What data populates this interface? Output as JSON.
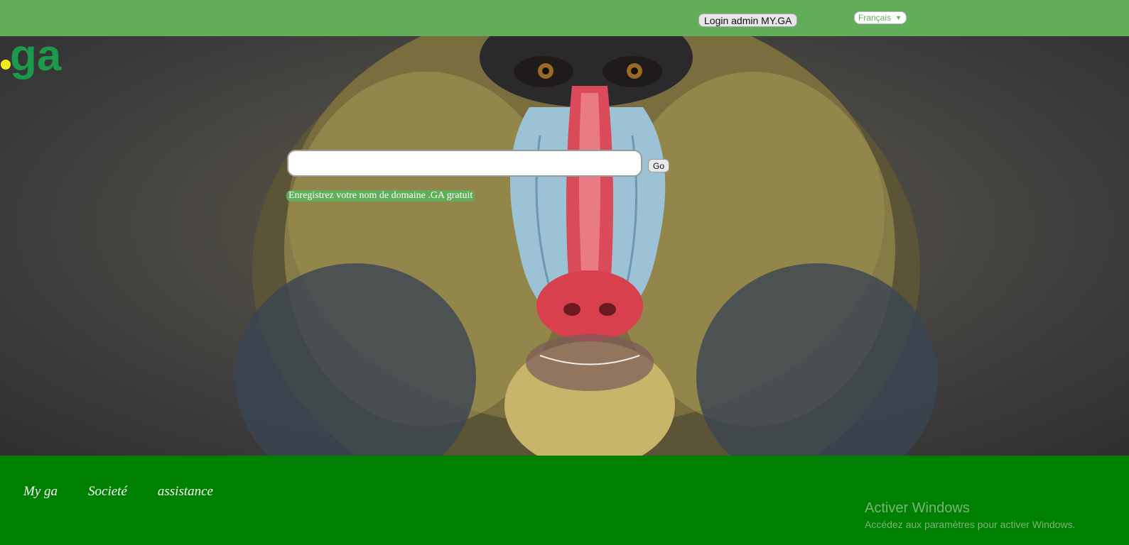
{
  "topbar": {
    "login_label": "Login admin MY.GA",
    "language": {
      "selected": "Français"
    }
  },
  "logo": {
    "text": ".ga"
  },
  "search": {
    "value": "",
    "placeholder": "",
    "go_label": "Go"
  },
  "promo": {
    "text": "Enregistrez votre nom de domaine .GA gratuit"
  },
  "footer": {
    "nav": [
      "My ga",
      "Societé",
      "assistance"
    ]
  },
  "windows_watermark": {
    "title": "Activer Windows",
    "subtitle": "Accédez aux paramètres pour activer Windows."
  },
  "colors": {
    "topbar": "#61ad5a",
    "footer": "#008000",
    "logo_green": "#1a9a4a",
    "logo_dot": "#f2ea1a"
  }
}
